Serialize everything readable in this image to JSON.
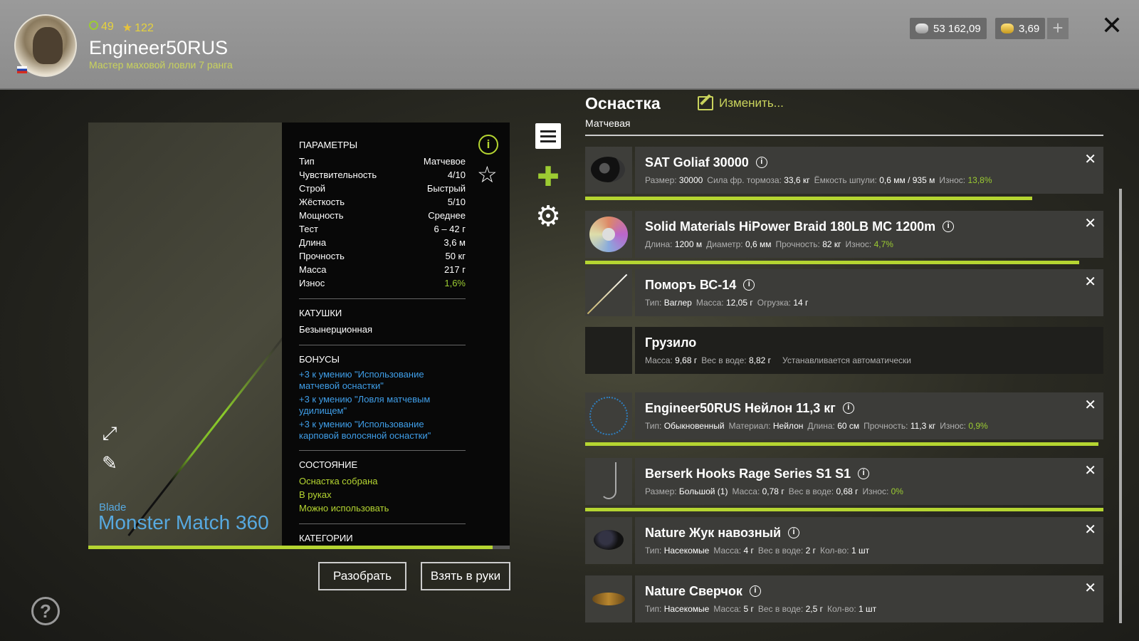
{
  "header": {
    "level": "49",
    "stars": "122",
    "username": "Engineer50RUS",
    "rank": "Мастер маховой ловли 7 ранга",
    "silver": "53 162,09",
    "gold": "3,69",
    "plus": "+",
    "close": "✕"
  },
  "rod": {
    "brand": "Blade",
    "name": "Monster Match 360",
    "progress": 0.96
  },
  "params": {
    "title": "ПАРАМЕТРЫ",
    "rows": [
      {
        "k": "Тип",
        "v": "Матчевое"
      },
      {
        "k": "Чувствительность",
        "v": "4/10"
      },
      {
        "k": "Строй",
        "v": "Быстрый"
      },
      {
        "k": "Жёсткость",
        "v": "5/10"
      },
      {
        "k": "Мощность",
        "v": "Среднее"
      },
      {
        "k": "Тест",
        "v": "6 – 42 г"
      },
      {
        "k": "Длина",
        "v": "3,6 м"
      },
      {
        "k": "Прочность",
        "v": "50 кг"
      },
      {
        "k": "Масса",
        "v": "217 г"
      },
      {
        "k": "Износ",
        "v": "1,6%"
      }
    ],
    "reels_title": "КАТУШКИ",
    "reels_value": "Безынерционная",
    "bonus_title": "БОНУСЫ",
    "bonuses": [
      "+3 к умению \"Использование матчевой оснастки\"",
      "+3 к умению \"Ловля матчевым удилищем\"",
      "+3 к умению \"Использование карповой волосяной оснастки\""
    ],
    "state_title": "СОСТОЯНИЕ",
    "states": [
      "Оснастка собрана",
      "В руках",
      "Можно использовать"
    ],
    "categories_title": "КАТЕГОРИИ"
  },
  "buttons": {
    "disassemble": "Разобрать",
    "take": "Взять в руки"
  },
  "rig": {
    "title": "Оснастка",
    "subtitle": "Матчевая",
    "edit": "Изменить..."
  },
  "items": [
    {
      "name": "SAT Goliaf 30000",
      "props": [
        {
          "k": "Размер:",
          "v": "30000"
        },
        {
          "k": "Сила фр. тормоза:",
          "v": "33,6 кг"
        },
        {
          "k": "Ёмкость шпули:",
          "v": "0,6 мм / 935 м"
        },
        {
          "k": "Износ:",
          "v": "13,8%"
        }
      ],
      "wear": 0.862
    },
    {
      "name": "Solid Materials HiPower Braid 180LB MC 1200m",
      "props": [
        {
          "k": "Длина:",
          "v": "1200 м"
        },
        {
          "k": "Диаметр:",
          "v": "0,6 мм"
        },
        {
          "k": "Прочность:",
          "v": "82 кг"
        },
        {
          "k": "Износ:",
          "v": "4,7%"
        }
      ],
      "wear": 0.953
    },
    {
      "name": "Поморъ ВС-14",
      "props": [
        {
          "k": "Тип:",
          "v": "Ваглер"
        },
        {
          "k": "Масса:",
          "v": "12,05 г"
        },
        {
          "k": "Огрузка:",
          "v": "14 г"
        }
      ]
    },
    {
      "name": "Грузило",
      "props": [
        {
          "k": "Масса:",
          "v": "9,68 г"
        },
        {
          "k": "Вес в воде:",
          "v": "8,82 г"
        }
      ],
      "note": "Устанавливается автоматически"
    },
    {
      "name": "Engineer50RUS Нейлон 11,3 кг",
      "props": [
        {
          "k": "Тип:",
          "v": "Обыкновенный"
        },
        {
          "k": "Материал:",
          "v": "Нейлон"
        },
        {
          "k": "Длина:",
          "v": "60 см"
        },
        {
          "k": "Прочность:",
          "v": "11,3 кг"
        },
        {
          "k": "Износ:",
          "v": "0,9%"
        }
      ],
      "wear": 0.991
    },
    {
      "name": "Berserk Hooks Rage Series S1 S1",
      "props": [
        {
          "k": "Размер:",
          "v": "Большой (1)"
        },
        {
          "k": "Масса:",
          "v": "0,78 г"
        },
        {
          "k": "Вес в воде:",
          "v": "0,68 г"
        },
        {
          "k": "Износ:",
          "v": "0%"
        }
      ],
      "wear": 1.0
    },
    {
      "name": "Nature Жук навозный",
      "props": [
        {
          "k": "Тип:",
          "v": "Насекомые"
        },
        {
          "k": "Масса:",
          "v": "4 г"
        },
        {
          "k": "Вес в воде:",
          "v": "2 г"
        },
        {
          "k": "Кол-во:",
          "v": "1 шт"
        }
      ]
    },
    {
      "name": "Nature Сверчок",
      "props": [
        {
          "k": "Тип:",
          "v": "Насекомые"
        },
        {
          "k": "Масса:",
          "v": "5 г"
        },
        {
          "k": "Вес в воде:",
          "v": "2,5 г"
        },
        {
          "k": "Кол-во:",
          "v": "1 шт"
        }
      ]
    }
  ]
}
